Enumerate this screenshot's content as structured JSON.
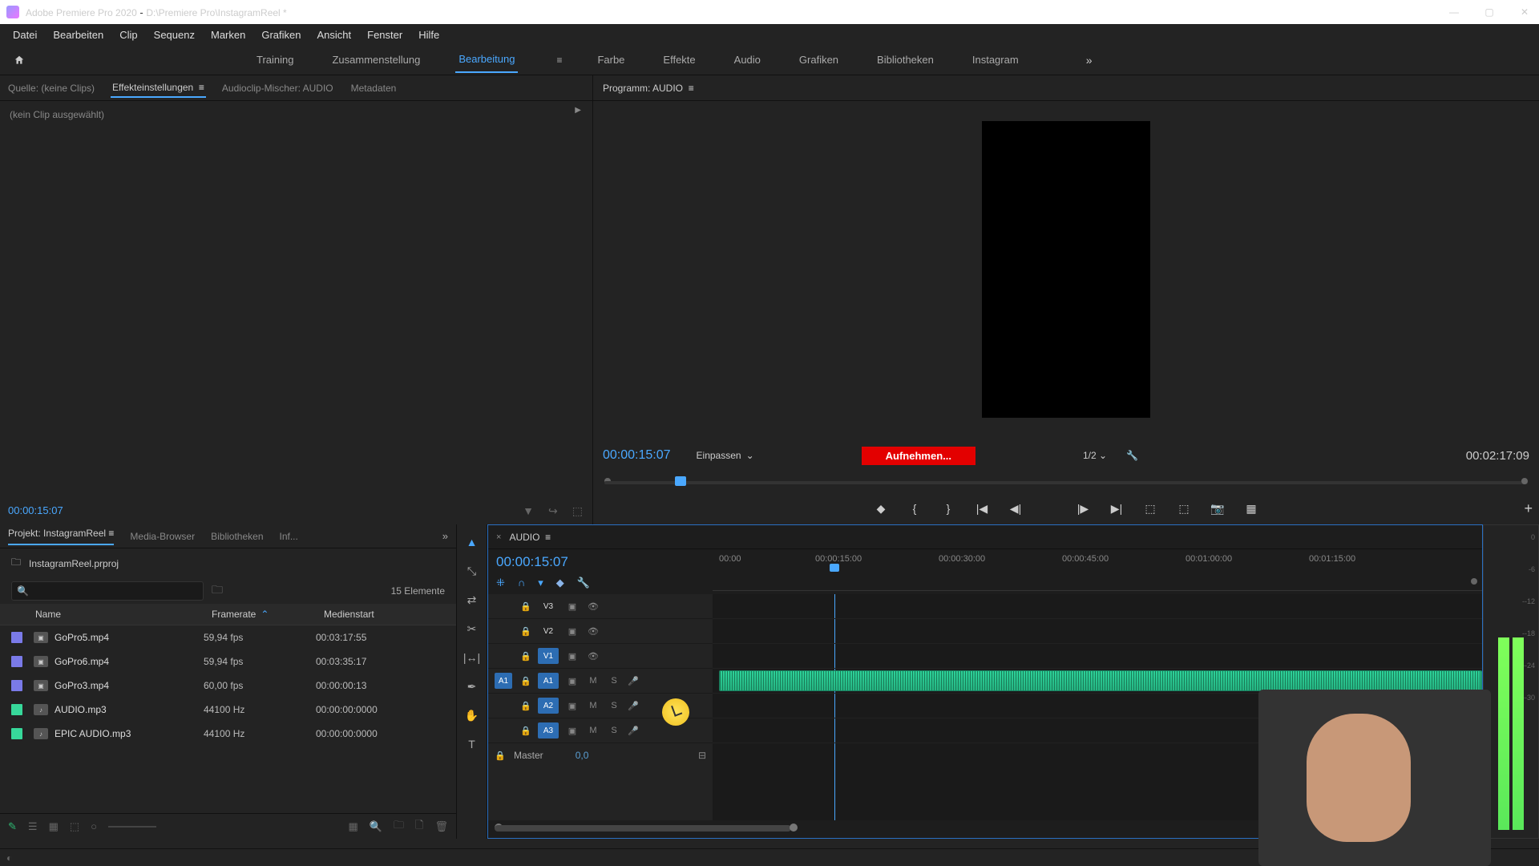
{
  "titlebar": {
    "app": "Adobe Premiere Pro 2020",
    "doc": "D:\\Premiere Pro\\InstagramReel *"
  },
  "menus": [
    "Datei",
    "Bearbeiten",
    "Clip",
    "Sequenz",
    "Marken",
    "Grafiken",
    "Ansicht",
    "Fenster",
    "Hilfe"
  ],
  "workspaces": [
    "Training",
    "Zusammenstellung",
    "Bearbeitung",
    "Farbe",
    "Effekte",
    "Audio",
    "Grafiken",
    "Bibliotheken",
    "Instagram"
  ],
  "workspace_active": "Bearbeitung",
  "source": {
    "tabs": [
      "Quelle: (keine Clips)",
      "Effekteinstellungen",
      "Audioclip-Mischer: AUDIO",
      "Metadaten"
    ],
    "active": "Effekteinstellungen",
    "noclip": "(kein Clip ausgewählt)",
    "tc": "00:00:15:07"
  },
  "program": {
    "label": "Programm: AUDIO",
    "tc_left": "00:00:15:07",
    "fit": "Einpassen",
    "rec": "Aufnehmen...",
    "zoom": "1/2",
    "tc_right": "00:02:17:09"
  },
  "project": {
    "tabs": [
      "Projekt: InstagramReel",
      "Media-Browser",
      "Bibliotheken",
      "Inf..."
    ],
    "active": "Projekt: InstagramReel",
    "file": "InstagramReel.prproj",
    "count": "15 Elemente",
    "cols": {
      "name": "Name",
      "fr": "Framerate",
      "ms": "Medienstart"
    },
    "items": [
      {
        "t": "v",
        "name": "GoPro5.mp4",
        "fr": "59,94 fps",
        "ms": "00:03:17:55"
      },
      {
        "t": "v",
        "name": "GoPro6.mp4",
        "fr": "59,94 fps",
        "ms": "00:03:35:17"
      },
      {
        "t": "v",
        "name": "GoPro3.mp4",
        "fr": "60,00 fps",
        "ms": "00:00:00:13"
      },
      {
        "t": "a",
        "name": "AUDIO.mp3",
        "fr": "44100 Hz",
        "ms": "00:00:00:0000"
      },
      {
        "t": "a",
        "name": "EPIC AUDIO.mp3",
        "fr": "44100 Hz",
        "ms": "00:00:00:0000"
      }
    ]
  },
  "timeline": {
    "seq": "AUDIO",
    "tc": "00:00:15:07",
    "ruler": [
      "00:00",
      "00:00:15:00",
      "00:00:30:00",
      "00:00:45:00",
      "00:01:00:00",
      "00:01:15:00"
    ],
    "vtracks": [
      "V3",
      "V2",
      "V1"
    ],
    "atracks": [
      "A1",
      "A2",
      "A3"
    ],
    "master": "Master",
    "masterval": "0,0"
  }
}
